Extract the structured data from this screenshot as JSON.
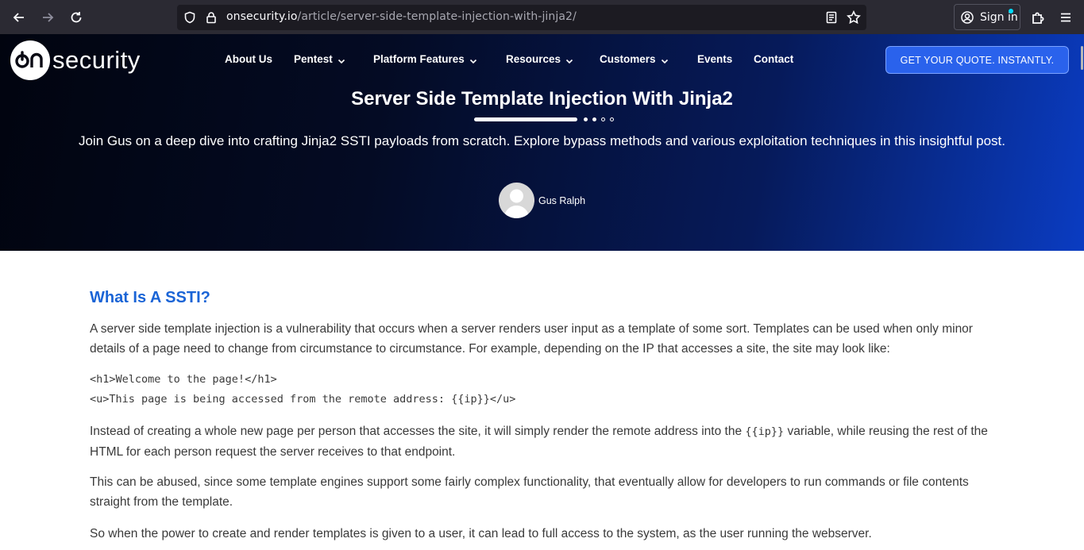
{
  "browser": {
    "url_host": "onsecurity.io",
    "url_path": "/article/server-side-template-injection-with-jinja2/",
    "signin_label": "Sign in"
  },
  "site": {
    "logo_text": "security",
    "nav": [
      {
        "label": "About Us",
        "dropdown": false
      },
      {
        "label": "Pentest",
        "dropdown": true
      },
      {
        "label": "Platform Features",
        "dropdown": true
      },
      {
        "label": "Resources",
        "dropdown": true
      },
      {
        "label": "Customers",
        "dropdown": true
      },
      {
        "label": "Events",
        "dropdown": false
      },
      {
        "label": "Contact",
        "dropdown": false
      }
    ],
    "cta_label": "GET YOUR QUOTE. INSTANTLY."
  },
  "hero": {
    "title": "Server Side Template Injection With Jinja2",
    "subtitle": "Join Gus on a deep dive into crafting Jinja2 SSTI payloads from scratch. Explore bypass methods and various exploitation techniques in this insightful post.",
    "author": "Gus Ralph"
  },
  "article": {
    "heading": "What Is A SSTI?",
    "p1": "A server side template injection is a vulnerability that occurs when a server renders user input as a template of some sort. Templates can be used when only minor details of a page need to change from circumstance to circumstance. For example, depending on the IP that accesses a site, the site may look like:",
    "code_line1": "<h1>Welcome to the page!</h1>",
    "code_line2": "<u>This page is being accessed from the remote address: {{ip}}</u>",
    "p2_before": "Instead of creating a whole new page per person that accesses the site, it will simply render the remote address into the ",
    "p2_code": "{{ip}}",
    "p2_after": " variable, while reusing the rest of the HTML for each person request the server receives to that endpoint.",
    "p3": "This can be abused, since some template engines support some fairly complex functionality, that eventually allow for developers to run commands or file contents straight from the template.",
    "p4": "So when the power to create and render templates is given to a user, it can lead to full access to the system, as the user running the webserver."
  },
  "colors": {
    "heading_blue": "#1a64d6",
    "cta_blue": "#2a62ec",
    "chrome_dark": "#2b2a33"
  }
}
